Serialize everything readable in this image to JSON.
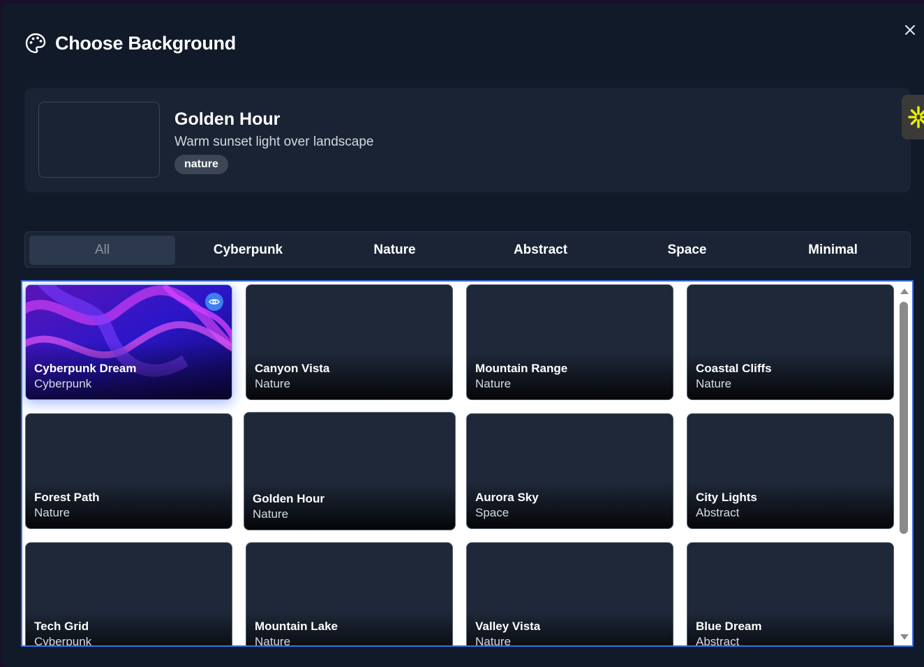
{
  "dialog": {
    "title": "Choose Background",
    "icon": "palette-icon",
    "close_icon": "close-icon"
  },
  "preview": {
    "name": "Golden Hour",
    "description": "Warm sunset light over landscape",
    "tag": "nature"
  },
  "tabs": [
    "All",
    "Cyberpunk",
    "Nature",
    "Abstract",
    "Space",
    "Minimal"
  ],
  "active_tab": "All",
  "backgrounds": [
    {
      "name": "Cyberpunk Dream",
      "category": "Cyberpunk"
    },
    {
      "name": "Canyon Vista",
      "category": "Nature"
    },
    {
      "name": "Mountain Range",
      "category": "Nature"
    },
    {
      "name": "Coastal Cliffs",
      "category": "Nature"
    },
    {
      "name": "Forest Path",
      "category": "Nature"
    },
    {
      "name": "Golden Hour",
      "category": "Nature"
    },
    {
      "name": "Aurora Sky",
      "category": "Space"
    },
    {
      "name": "City Lights",
      "category": "Abstract"
    },
    {
      "name": "Tech Grid",
      "category": "Cyberpunk"
    },
    {
      "name": "Mountain Lake",
      "category": "Nature"
    },
    {
      "name": "Valley Vista",
      "category": "Nature"
    },
    {
      "name": "Blue Dream",
      "category": "Abstract"
    }
  ],
  "colors": {
    "dialog_bg": "#111a29",
    "panel_bg": "#1a2333",
    "accent": "#3f7ef0",
    "selection_border": "#3b6fe8"
  }
}
